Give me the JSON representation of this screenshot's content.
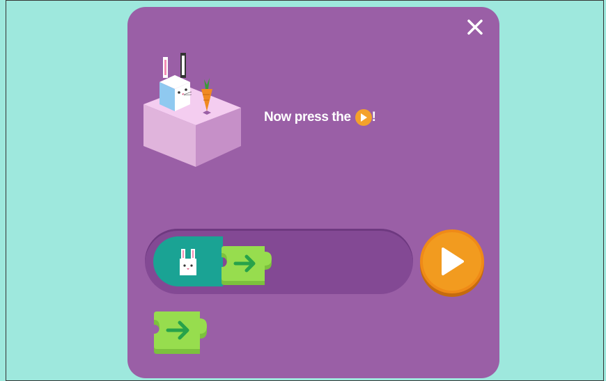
{
  "dialog": {
    "instruction_text": "Now press the",
    "instruction_suffix": "!",
    "close_icon": "close-icon",
    "inline_icon": "play-icon"
  },
  "sequence": {
    "start_block_icon": "bunny-icon",
    "blocks": [
      {
        "icon": "arrow-right-icon",
        "direction": "right"
      }
    ]
  },
  "tray": {
    "blocks": [
      {
        "icon": "arrow-right-icon",
        "direction": "right"
      }
    ]
  },
  "run_button": {
    "icon": "play-icon"
  },
  "colors": {
    "background": "#9ee8dd",
    "panel": "#9a5fa6",
    "track": "#834994",
    "start_block": "#1aa394",
    "code_block": "#8fd94a",
    "run_button": "#f29b1f"
  }
}
